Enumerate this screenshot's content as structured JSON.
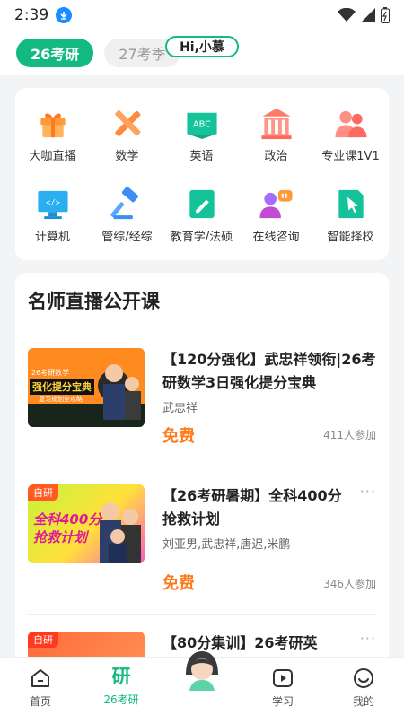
{
  "status": {
    "time": "2:39"
  },
  "tabs": [
    {
      "label": "26考研",
      "active": true
    },
    {
      "label": "27考季",
      "active": false
    }
  ],
  "grid": [
    {
      "label": "大咖直播",
      "icon": "gift-icon"
    },
    {
      "label": "数学",
      "icon": "math-tools-icon"
    },
    {
      "label": "英语",
      "icon": "abc-book-icon"
    },
    {
      "label": "政治",
      "icon": "building-icon"
    },
    {
      "label": "专业课1V1",
      "icon": "people-icon"
    },
    {
      "label": "计算机",
      "icon": "monitor-code-icon"
    },
    {
      "label": "管综/经综",
      "icon": "gavel-icon"
    },
    {
      "label": "教育学/法硕",
      "icon": "book-pencil-icon"
    },
    {
      "label": "在线咨询",
      "icon": "chat-person-icon"
    },
    {
      "label": "智能择校",
      "icon": "pointer-icon"
    }
  ],
  "section": {
    "title": "名师直播公开课"
  },
  "courses": [
    {
      "thumb_tag": "26考研数学",
      "thumb_text": "强化提分宝典",
      "thumb_sub": "复习规划全攻略",
      "title": "【120分强化】武忠祥领衔|26考研数学3日强化提分宝典",
      "teacher": "武忠祥",
      "price": "免费",
      "count": "411人参加"
    },
    {
      "thumb_tag": "自研",
      "thumb_text": "全科400分",
      "thumb_text2": "抢救计划",
      "title": "【26考研暑期】全科400分抢救计划",
      "teacher": "刘亚男,武忠祥,唐迟,米鹏",
      "price": "免费",
      "count": "346人参加",
      "more": "···"
    },
    {
      "thumb_tag": "自研",
      "title": "【80分集训】26考研英",
      "more": "···"
    }
  ],
  "nav": [
    {
      "label": "首页",
      "icon": "home-icon",
      "active": false
    },
    {
      "label": "26考研",
      "icon": "yan-char-icon",
      "active": true,
      "glyph": "研"
    },
    {
      "label": "学习",
      "icon": "play-icon",
      "active": false
    },
    {
      "label": "我的",
      "icon": "smiley-icon",
      "active": false
    }
  ],
  "assistant": {
    "label": "Hi,小慕"
  },
  "colors": {
    "accent": "#12b981",
    "price": "#ff7a1a"
  }
}
